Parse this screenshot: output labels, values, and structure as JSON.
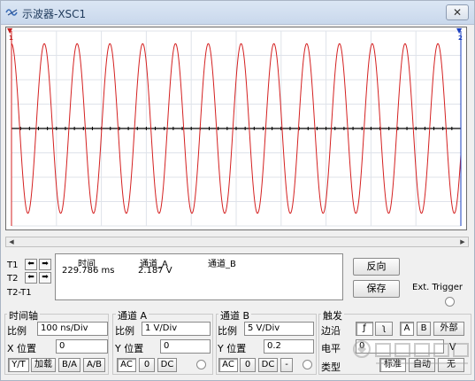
{
  "window": {
    "title": "示波器-XSC1",
    "close_label": "✕"
  },
  "icons": {
    "app": "oscilloscope-icon",
    "close": "close-icon",
    "trigger_marker": "trigger-marker-icon"
  },
  "colors": {
    "trace_a": "#d42020",
    "trace_b": "#1a3fbf",
    "grid": "#dfe3ea",
    "axis": "#000000"
  },
  "scope": {
    "marker_t1": "1",
    "marker_t2": "2",
    "marker_trigger": "▼",
    "trace": {
      "cycles_visible": 13.7,
      "amplitude_fraction": 0.87,
      "phase": 1.5708
    }
  },
  "readout": {
    "t1_label": "T1",
    "t2_label": "T2",
    "t2_t1_label": "T2-T1",
    "headers": {
      "time": "时间",
      "channel_a": "通道_A",
      "channel_b": "通道_B"
    },
    "values": {
      "time": "229.786 ms",
      "channel_a": "2.187 V"
    }
  },
  "right_buttons": {
    "reverse": "反向",
    "save": "保存",
    "ext_trigger": "Ext. Trigger"
  },
  "timebase": {
    "title": "时间轴",
    "scale_label": "比例",
    "scale_value": "100 ns/Div",
    "xpos_label": "X 位置",
    "xpos_value": "0",
    "buttons": [
      "Y/T",
      "加载",
      "B/A",
      "A/B"
    ]
  },
  "channel_a": {
    "title": "通道 A",
    "scale_label": "比例",
    "scale_value": "1  V/Div",
    "ypos_label": "Y 位置",
    "ypos_value": "0",
    "buttons": [
      "AC",
      "0",
      "DC"
    ]
  },
  "channel_b": {
    "title": "通道 B",
    "scale_label": "比例",
    "scale_value": "5  V/Div",
    "ypos_label": "Y 位置",
    "ypos_value": "0.2",
    "buttons": [
      "AC",
      "0",
      "DC",
      "-"
    ]
  },
  "trigger": {
    "title": "触发",
    "edge_label": "边沿",
    "level_label": "电平",
    "type_label": "类型",
    "edge_buttons": [
      "ƒ",
      "ʅ",
      "A",
      "B",
      "外部"
    ],
    "level_value": "0",
    "level_unit": "V",
    "type_buttons": [
      "标准",
      "自动",
      "无"
    ]
  }
}
